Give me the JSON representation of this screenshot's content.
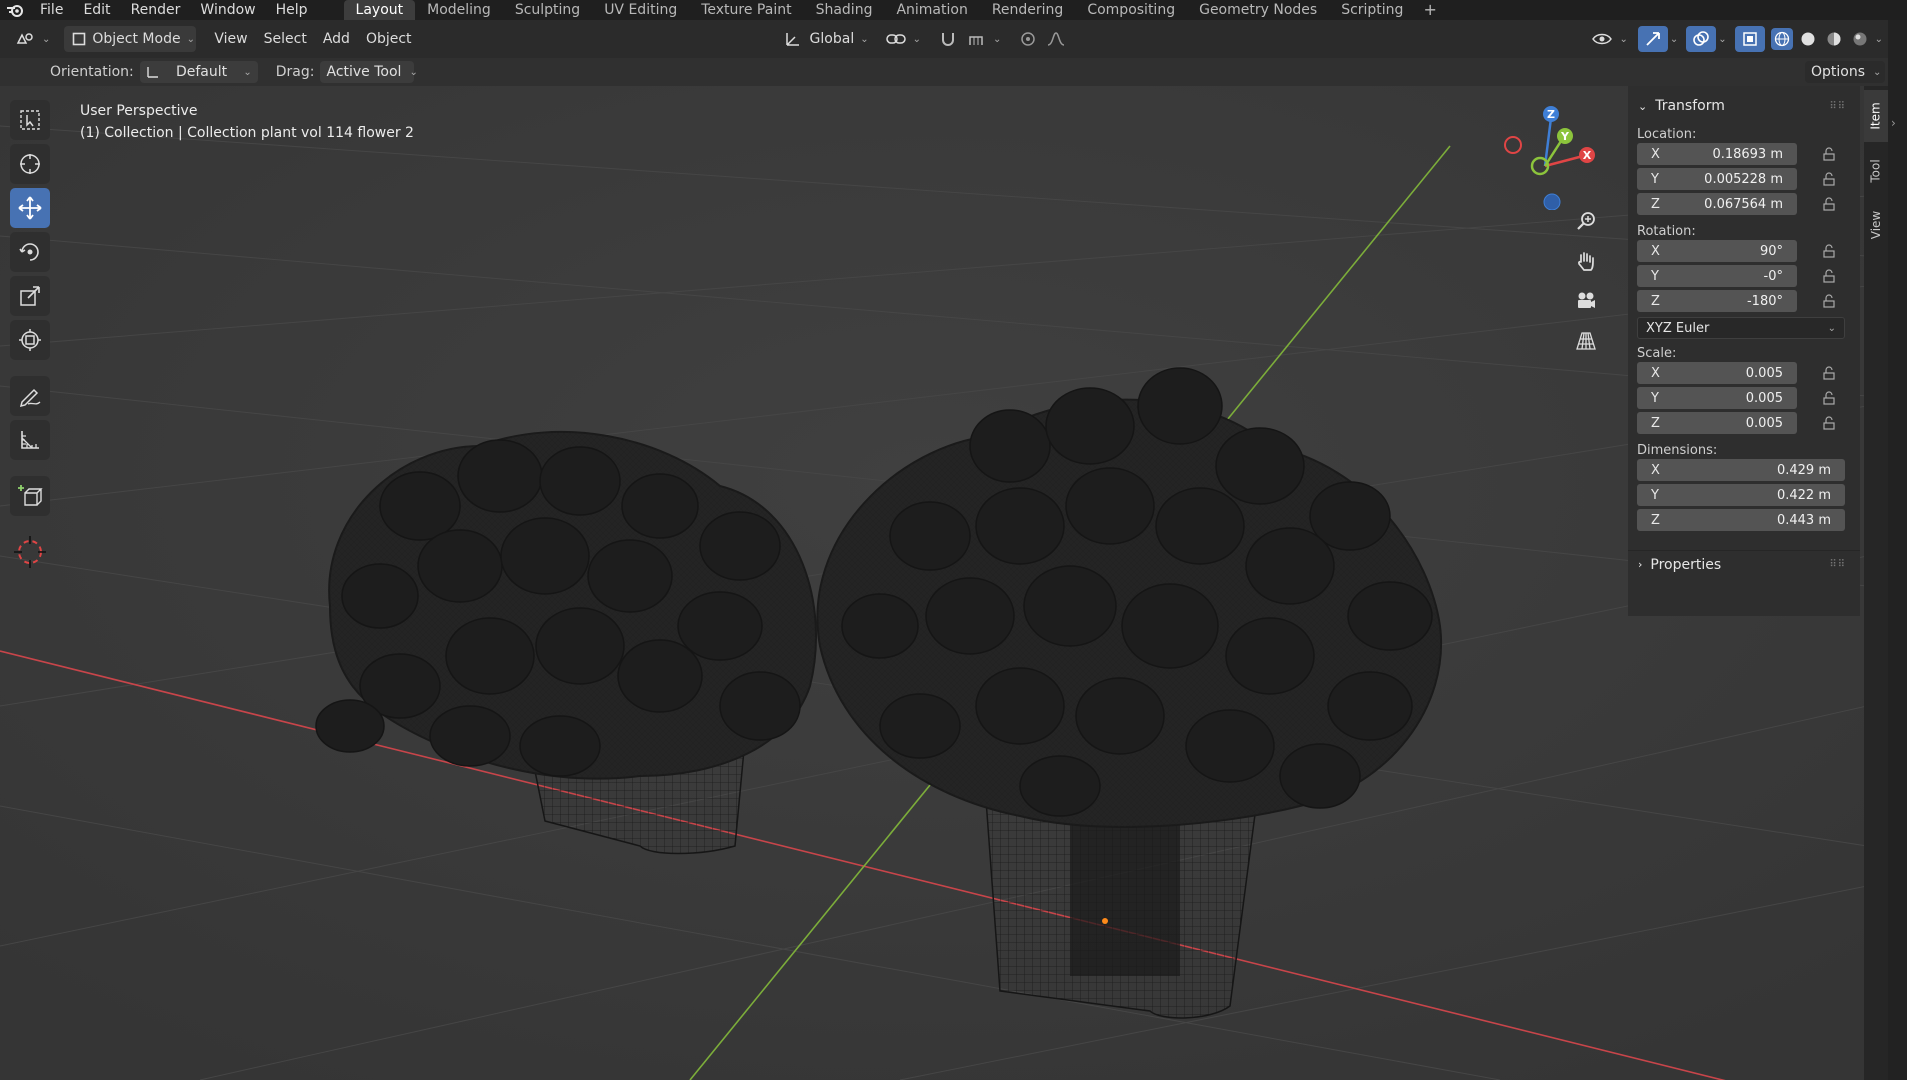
{
  "menu": {
    "items": [
      "File",
      "Edit",
      "Render",
      "Window",
      "Help"
    ]
  },
  "workspaces": {
    "tabs": [
      "Layout",
      "Modeling",
      "Sculpting",
      "UV Editing",
      "Texture Paint",
      "Shading",
      "Animation",
      "Rendering",
      "Compositing",
      "Geometry Nodes",
      "Scripting"
    ],
    "active": "Layout",
    "add_label": "+"
  },
  "header": {
    "mode": "Object Mode",
    "view": "View",
    "select": "Select",
    "add": "Add",
    "object": "Object",
    "transform_orientation": "Global"
  },
  "tool_settings": {
    "orientation_label": "Orientation:",
    "orientation_value": "Default",
    "drag_label": "Drag:",
    "drag_value": "Active Tool",
    "options": "Options"
  },
  "viewport": {
    "perspective": "User Perspective",
    "collection": "(1) Collection | Collection plant vol 114 flower 2"
  },
  "gizmo": {
    "x": "X",
    "y": "Y",
    "z": "Z",
    "colors": {
      "x": "#e04545",
      "y": "#8cc43c",
      "z": "#3f7fd6"
    }
  },
  "npanel": {
    "transform_title": "Transform",
    "location_label": "Location:",
    "location": [
      {
        "axis": "X",
        "value": "0.18693 m"
      },
      {
        "axis": "Y",
        "value": "0.005228 m"
      },
      {
        "axis": "Z",
        "value": "0.067564 m"
      }
    ],
    "rotation_label": "Rotation:",
    "rotation": [
      {
        "axis": "X",
        "value": "90°"
      },
      {
        "axis": "Y",
        "value": "-0°"
      },
      {
        "axis": "Z",
        "value": "-180°"
      }
    ],
    "rotation_mode": "XYZ Euler",
    "scale_label": "Scale:",
    "scale": [
      {
        "axis": "X",
        "value": "0.005"
      },
      {
        "axis": "Y",
        "value": "0.005"
      },
      {
        "axis": "Z",
        "value": "0.005"
      }
    ],
    "dimensions_label": "Dimensions:",
    "dimensions": [
      {
        "axis": "X",
        "value": "0.429 m"
      },
      {
        "axis": "Y",
        "value": "0.422 m"
      },
      {
        "axis": "Z",
        "value": "0.443 m"
      }
    ],
    "properties_title": "Properties"
  },
  "side_tabs": [
    "Item",
    "Tool",
    "View"
  ],
  "colors": {
    "accent": "#4772b3",
    "x_axis_line": "#c8454a",
    "y_axis_line": "#7cad3a"
  }
}
